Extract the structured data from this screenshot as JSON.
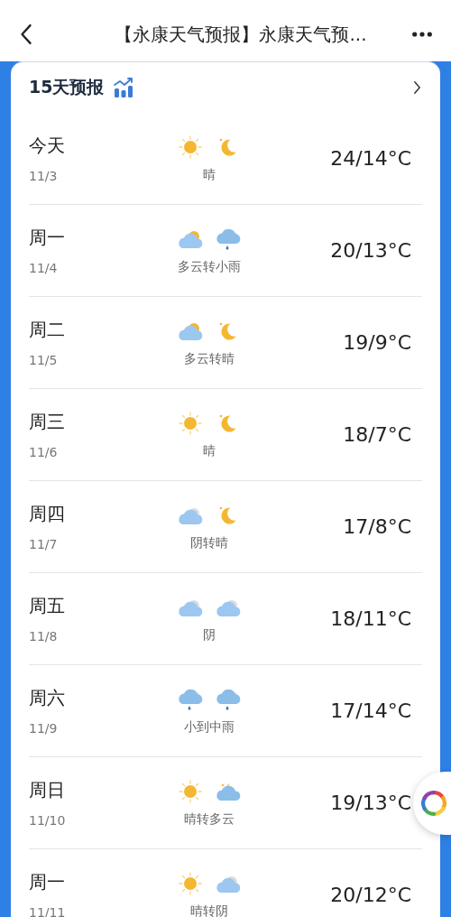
{
  "nav_bar": {
    "title": "【永康天气预报】永康天气预..."
  },
  "forecast": {
    "title": "15天预报",
    "days": [
      {
        "day": "今天",
        "date": "11/3",
        "day_icon": {
          "kind": "sun"
        },
        "night_icon": {
          "kind": "moon"
        },
        "condition": "晴",
        "temperature": "24/14°C"
      },
      {
        "day": "周一",
        "date": "11/4",
        "day_icon": {
          "kind": "partly-cloudy"
        },
        "night_icon": {
          "kind": "rain"
        },
        "condition": "多云转小雨",
        "temperature": "20/13°C"
      },
      {
        "day": "周二",
        "date": "11/5",
        "day_icon": {
          "kind": "partly-cloudy"
        },
        "night_icon": {
          "kind": "moon"
        },
        "condition": "多云转晴",
        "temperature": "19/9°C"
      },
      {
        "day": "周三",
        "date": "11/6",
        "day_icon": {
          "kind": "sun"
        },
        "night_icon": {
          "kind": "moon"
        },
        "condition": "晴",
        "temperature": "18/7°C"
      },
      {
        "day": "周四",
        "date": "11/7",
        "day_icon": {
          "kind": "cloud"
        },
        "night_icon": {
          "kind": "moon"
        },
        "condition": "阴转晴",
        "temperature": "17/8°C"
      },
      {
        "day": "周五",
        "date": "11/8",
        "day_icon": {
          "kind": "cloud"
        },
        "night_icon": {
          "kind": "cloud"
        },
        "condition": "阴",
        "temperature": "18/11°C"
      },
      {
        "day": "周六",
        "date": "11/9",
        "day_icon": {
          "kind": "rain"
        },
        "night_icon": {
          "kind": "rain"
        },
        "condition": "小到中雨",
        "temperature": "17/14°C"
      },
      {
        "day": "周日",
        "date": "11/10",
        "day_icon": {
          "kind": "sun"
        },
        "night_icon": {
          "kind": "cloudy-night"
        },
        "condition": "晴转多云",
        "temperature": "19/13°C"
      },
      {
        "day": "周一",
        "date": "11/11",
        "day_icon": {
          "kind": "sun"
        },
        "night_icon": {
          "kind": "cloud"
        },
        "condition": "晴转阴",
        "temperature": "20/12°C"
      }
    ]
  }
}
